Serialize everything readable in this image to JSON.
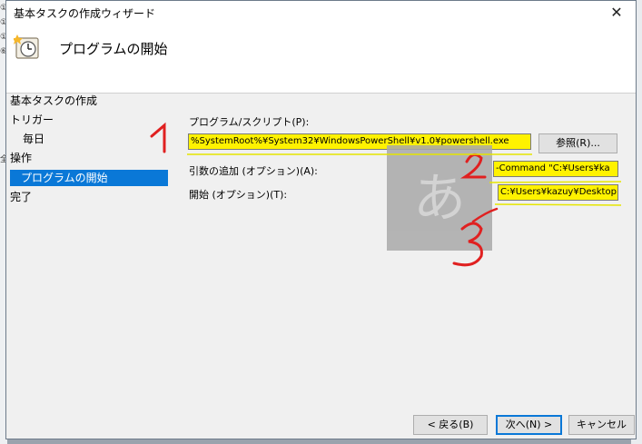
{
  "window": {
    "title": "基本タスクの作成ウィザード",
    "close_label": "✕"
  },
  "header": {
    "title": "プログラムの開始",
    "icon": "clock-task-icon"
  },
  "steps": [
    {
      "label": "基本タスクの作成"
    },
    {
      "label": "トリガー"
    },
    {
      "label": "毎日"
    },
    {
      "label": "操作"
    },
    {
      "label": "プログラムの開始"
    },
    {
      "label": "完了"
    }
  ],
  "form": {
    "program_label": "プログラム/スクリプト(P):",
    "program_value": "%SystemRoot%¥System32¥WindowsPowerShell¥v1.0¥powershell.exe",
    "browse_label": "参照(R)...",
    "args_label": "引数の追加 (オプション)(A):",
    "args_value": "-Command \"C:¥Users¥ka",
    "start_label": "開始 (オプション)(T):",
    "start_value": "C:¥Users¥kazuy¥Desktop"
  },
  "footer": {
    "back_label": "< 戻る(B)",
    "next_label": "次へ(N) >",
    "cancel_label": "キャンセル"
  },
  "ime": {
    "char": "あ"
  },
  "annotations": {
    "n1": "1",
    "n2": "2",
    "n3": "3",
    "color": "#e02020"
  }
}
